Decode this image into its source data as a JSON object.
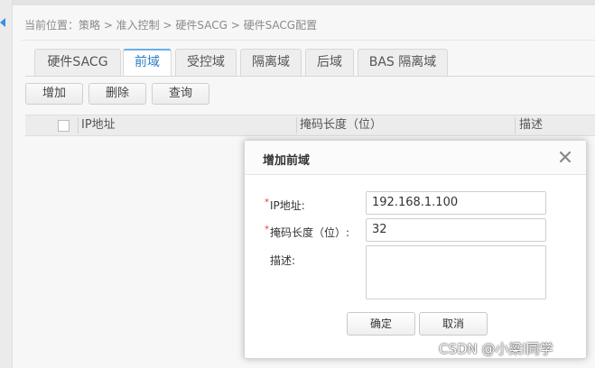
{
  "breadcrumb": {
    "text": "当前位置：策略 > 准入控制 > 硬件SACG > 硬件SACG配置"
  },
  "tabs": [
    {
      "label": "硬件SACG",
      "active": false
    },
    {
      "label": "前域",
      "active": true
    },
    {
      "label": "受控域",
      "active": false
    },
    {
      "label": "隔离域",
      "active": false
    },
    {
      "label": "后域",
      "active": false
    },
    {
      "label": "BAS 隔离域",
      "active": false
    }
  ],
  "toolbar": {
    "add_label": "增加",
    "delete_label": "删除",
    "query_label": "查询"
  },
  "table": {
    "columns": [
      "IP地址",
      "掩码长度（位）",
      "描述"
    ]
  },
  "dialog": {
    "title": "增加前域",
    "ip_label": "IP地址:",
    "ip_value": "192.168.1.100",
    "mask_label": "掩码长度（位）:",
    "mask_value": "32",
    "desc_label": "描述:",
    "desc_value": "",
    "required_mark": "*",
    "ok_label": "确定",
    "cancel_label": "取消",
    "close_icon": "close-icon"
  },
  "watermark": "CSDN @小梁l同学",
  "colors": {
    "accent": "#2a7ec7",
    "required": "#e03c3c"
  }
}
